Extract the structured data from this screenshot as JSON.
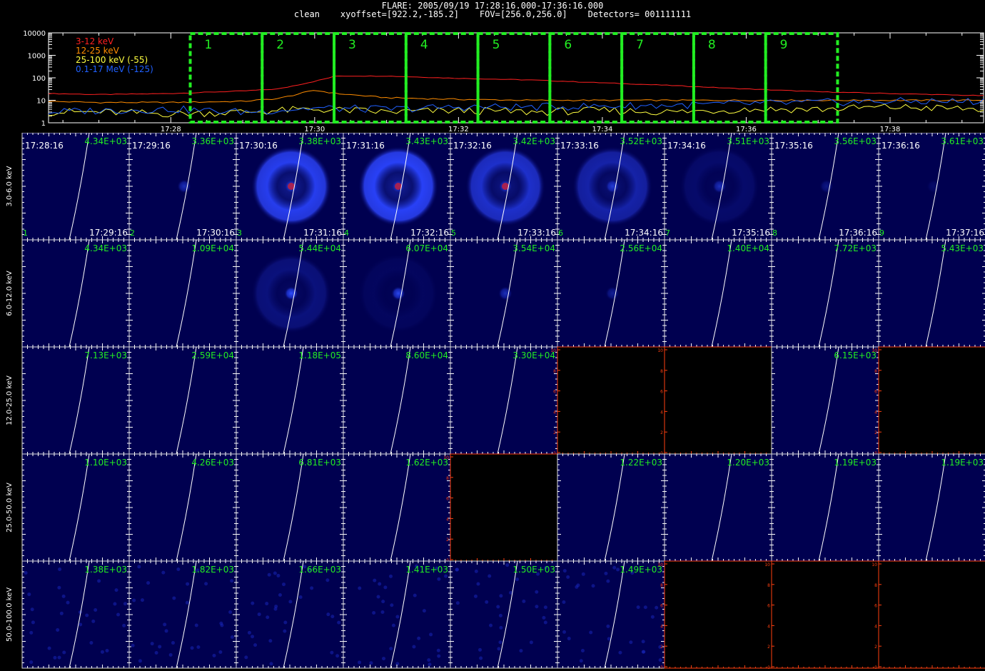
{
  "header": {
    "title": "FLARE: 2005/09/19 17:28:16.000-17:36:16.000",
    "params": "clean    xyoffset=[922.2,-185.2]    FOV=[256.0,256.0]    Detectors= 001111111"
  },
  "chart_data": {
    "type": "line",
    "lightcurve": {
      "yscale": "log",
      "ylim": [
        1,
        10000
      ],
      "ytick_labels": [
        "1",
        "10",
        "100",
        "1000",
        "10000"
      ],
      "xtick_labels": [
        "17:28",
        "17:30",
        "17:32",
        "17:34",
        "17:36",
        "17:38"
      ],
      "xtick_minutes": [
        28,
        30,
        32,
        34,
        36,
        38
      ],
      "xlim_minutes": [
        26.3,
        39.3
      ],
      "series": [
        {
          "name": "3-12 keV",
          "color": "#ff2020",
          "minutes": [
            26.3,
            27,
            28,
            29,
            29.5,
            30,
            30.3,
            31,
            32,
            33,
            34,
            35,
            36,
            37,
            38,
            39.3
          ],
          "values": [
            20,
            18,
            20,
            26,
            32,
            70,
            120,
            120,
            95,
            80,
            60,
            45,
            32,
            24,
            20,
            16
          ]
        },
        {
          "name": "12-25 keV",
          "color": "#ff8c00",
          "minutes": [
            26.3,
            27,
            28,
            29,
            29.5,
            30,
            30.3,
            31,
            32,
            33,
            34,
            35,
            36,
            37,
            38,
            39.3
          ],
          "values": [
            9,
            8,
            8,
            9,
            12,
            28,
            20,
            13,
            11,
            10,
            10,
            10,
            10,
            10,
            10,
            10
          ]
        },
        {
          "name": "25-100 keV (-55)",
          "color": "#ffff40",
          "minutes": [
            26.3,
            27,
            28,
            29,
            30,
            31,
            32,
            33,
            34,
            35,
            36,
            37,
            38,
            39.3
          ],
          "values": [
            3,
            3,
            2.5,
            3,
            4,
            3,
            3.5,
            3,
            3.5,
            3,
            4,
            4,
            5,
            4
          ]
        },
        {
          "name": "0.1-17 MeV (-125)",
          "color": "#2060ff",
          "minutes": [
            26.3,
            27,
            28,
            29,
            30,
            31,
            32,
            33,
            34,
            35,
            36,
            37,
            38,
            39.3
          ],
          "values": [
            3,
            3.5,
            4,
            3,
            4.5,
            4,
            5,
            5,
            5.5,
            6,
            7,
            8,
            9,
            9
          ]
        }
      ],
      "intervals": [
        {
          "label": "1",
          "start": 28.27,
          "end": 29.27
        },
        {
          "label": "2",
          "start": 29.27,
          "end": 30.27
        },
        {
          "label": "3",
          "start": 30.27,
          "end": 31.27
        },
        {
          "label": "4",
          "start": 31.27,
          "end": 32.27
        },
        {
          "label": "5",
          "start": 32.27,
          "end": 33.27
        },
        {
          "label": "6",
          "start": 33.27,
          "end": 34.27
        },
        {
          "label": "7",
          "start": 34.27,
          "end": 35.27
        },
        {
          "label": "8",
          "start": 35.27,
          "end": 36.27
        },
        {
          "label": "9",
          "start": 36.27,
          "end": 37.27
        }
      ]
    },
    "image_grid": {
      "energy_bands": [
        "3.0-6.0 keV",
        "6.0-12.0 keV",
        "12.0-25.0 keV",
        "25.0-50.0 keV",
        "50.0-100.0 keV"
      ],
      "start_times": [
        "17:28:16",
        "17:29:16",
        "17:30:16",
        "17:31:16",
        "17:32:16",
        "17:33:16",
        "17:34:16",
        "17:35:16",
        "17:36:16"
      ],
      "end_times": [
        "17:29:16",
        "17:30:16",
        "17:31:16",
        "17:32:16",
        "17:33:16",
        "17:34:16",
        "17:35:16",
        "17:36:16",
        "17:37:16"
      ],
      "interval_numbers": [
        "1",
        "2",
        "3",
        "4",
        "5",
        "6",
        "7",
        "8",
        "9"
      ],
      "peak_values": [
        [
          "4.34E+03",
          "3.36E+03",
          "3.38E+03",
          "3.43E+03",
          "3.42E+03",
          "3.52E+03",
          "3.51E+03",
          "3.56E+03",
          "3.61E+03"
        ],
        [
          "4.34E+03",
          "1.09E+04",
          "5.44E+04",
          "6.07E+04",
          "3.54E+04",
          "2.56E+04",
          "1.40E+04",
          "7.72E+03",
          "5.43E+03"
        ],
        [
          "7.13E+03",
          "2.59E+04",
          "1.18E+05",
          "8.60E+04",
          "3.30E+04",
          "",
          "",
          "6.15E+03",
          ""
        ],
        [
          "1.10E+03",
          "4.26E+03",
          "6.81E+03",
          "1.62E+03",
          "",
          "1.22E+03",
          "1.20E+03",
          "1.19E+03",
          "1.19E+03"
        ],
        [
          "1.38E+03",
          "1.82E+03",
          "1.66E+03",
          "1.41E+03",
          "1.50E+03",
          "1.49E+03",
          "",
          "",
          ""
        ]
      ],
      "empty_axis_ticks": [
        "0",
        "2",
        "4",
        "6",
        "8",
        "10"
      ],
      "empty_cells": [
        [
          2,
          5
        ],
        [
          2,
          6
        ],
        [
          2,
          8
        ],
        [
          3,
          4
        ],
        [
          4,
          6
        ],
        [
          4,
          7
        ],
        [
          4,
          8
        ]
      ],
      "ring_intensity": [
        [
          0,
          0,
          0.9,
          0.95,
          0.7,
          0.5,
          0.15,
          0,
          0
        ],
        [
          0,
          0,
          0.25,
          0.08,
          0,
          0,
          0,
          0,
          0
        ],
        [
          0,
          0,
          0,
          0,
          0,
          0,
          0,
          0,
          0
        ],
        [
          0,
          0,
          0,
          0,
          0,
          0,
          0,
          0,
          0
        ],
        [
          0,
          0,
          0,
          0,
          0,
          0,
          0,
          0,
          0
        ]
      ],
      "source_intensity": [
        [
          0,
          0.6,
          0.6,
          0.5,
          0.6,
          0.7,
          0.6,
          0.3,
          0.15
        ],
        [
          0,
          0,
          1,
          0.9,
          0.6,
          0.4,
          0,
          0,
          0
        ],
        [
          0,
          0,
          0,
          0,
          0,
          0,
          0,
          0,
          0
        ],
        [
          0,
          0,
          0,
          0,
          0,
          0,
          0,
          0,
          0
        ],
        [
          0,
          0,
          0,
          0,
          0,
          0,
          0,
          0,
          0
        ]
      ],
      "red_core": [
        [
          0,
          0,
          1,
          1,
          1,
          0,
          0,
          0,
          0
        ]
      ],
      "noise_rows": [
        4
      ]
    }
  }
}
